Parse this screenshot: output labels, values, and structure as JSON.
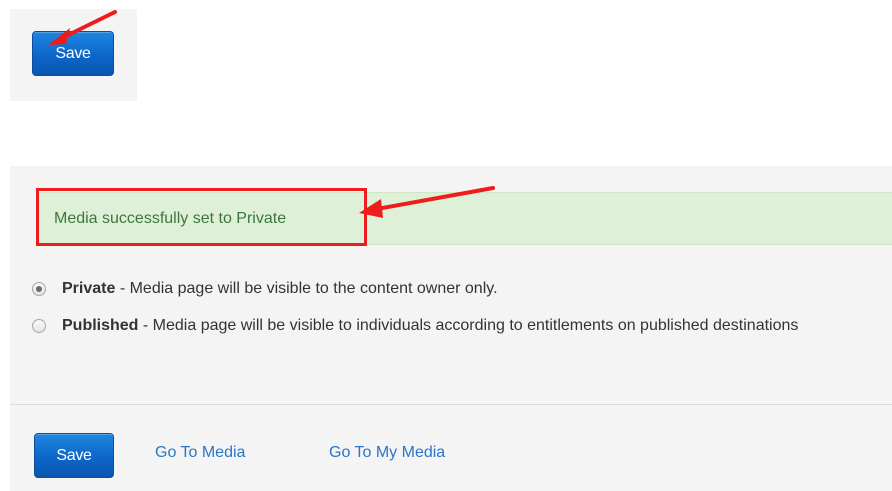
{
  "top_toolbar": {
    "save_label": "Save"
  },
  "alert": {
    "message": "Media successfully set to Private"
  },
  "visibility_options": [
    {
      "name": "Private",
      "description": " - Media page will be visible to the content owner only.",
      "selected": true
    },
    {
      "name": "Published",
      "description": " - Media page will be visible to individuals according to entitlements on published destinations",
      "selected": false
    }
  ],
  "footer": {
    "save_label": "Save",
    "go_to_media_label": "Go To Media",
    "go_to_my_media_label": "Go To My Media"
  },
  "colors": {
    "primary_button": "#0d66c8",
    "success_bg": "#dff0d8",
    "success_text": "#3c763d",
    "annotation_red": "#ee1c1c",
    "link": "#2a76c6"
  }
}
